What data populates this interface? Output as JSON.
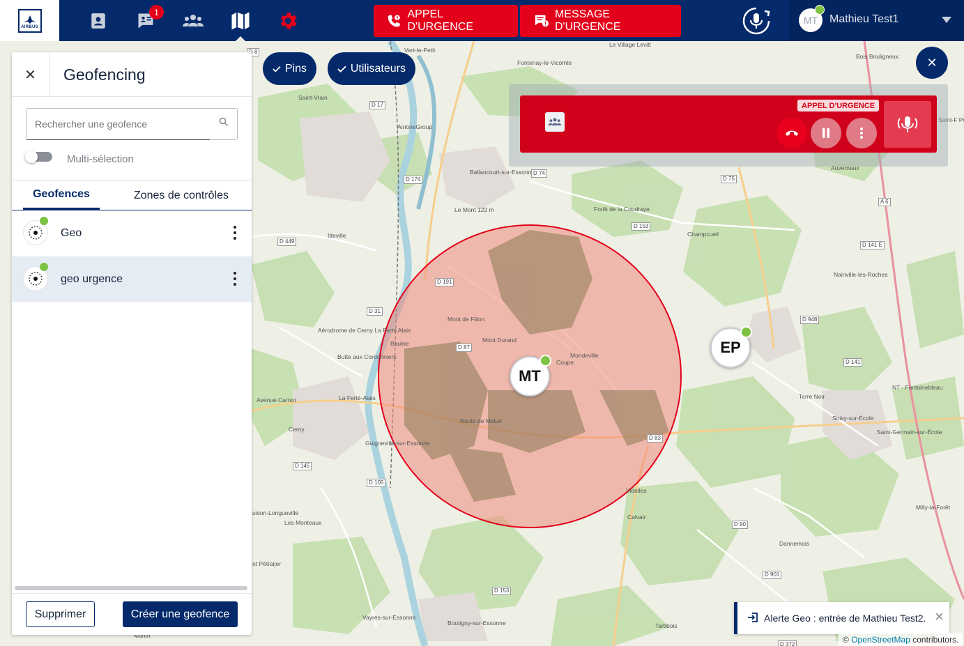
{
  "topbar": {
    "logo_text": "AIRBUS",
    "nav": [
      {
        "name": "contacts"
      },
      {
        "name": "messages",
        "badge": "1"
      },
      {
        "name": "groups"
      },
      {
        "name": "map"
      },
      {
        "name": "settings"
      }
    ],
    "emergency_call_label": "APPEL D'URGENCE",
    "emergency_message_label": "MESSAGE D'URGENCE",
    "user": {
      "initials": "MT",
      "name": "Mathieu Test1",
      "status_color": "#7dc242"
    }
  },
  "panel": {
    "title": "Geofencing",
    "search_placeholder": "Rechercher une geofence",
    "multiselect_label": "Multi-sélection",
    "tabs": [
      {
        "label": "Geofences",
        "active": true
      },
      {
        "label": "Zones de contrôles",
        "active": false
      }
    ],
    "geofences": [
      {
        "name": "Geo",
        "selected": false
      },
      {
        "name": "geo urgence",
        "selected": true
      }
    ],
    "delete_label": "Supprimer",
    "create_label": "Créer une geofence"
  },
  "filters": {
    "pins_label": "Pins",
    "users_label": "Utilisateurs"
  },
  "call_widget": {
    "badge": "APPEL D'URGENCE"
  },
  "markers": [
    {
      "initials": "MT"
    },
    {
      "initials": "EP"
    }
  ],
  "map_labels": {
    "places": [
      "Vert-le-Petit",
      "Fontenay-le-Vicomte",
      "Le Village Levitt",
      "Saint-Vrain",
      "AirioneGroup",
      "Ballancourt-sur-Essonne",
      "Le Mont 122 m",
      "Forêt de la Coudraye",
      "Champcueil",
      "Auvernaux",
      "Itteville",
      "Mont de Fillon",
      "Mont Durand",
      "Baulne",
      "Butte aux Cordonniers",
      "Aérodrome de Cerny La Ferté Alais",
      "Mondeville",
      "Coupe",
      "La Ferté-Alais",
      "Cerny",
      "Guigneville-sur-Essonne",
      "Nainville-les-Roches",
      "Soisy-sur-École",
      "Saint-Germain-sur-École",
      "Terre Noir",
      "Videlles",
      "Calvair",
      "Dannemois",
      "Milly-la-Forêt",
      "uison-Longueville",
      "Les Monteaux",
      "Boutigny-sur-Essonne",
      "Vayres-sur-Essonne",
      "Tartibois",
      "Martin",
      "Saint-F Pont",
      "Bois Bouligneux",
      "Route de Melun",
      "Avenue Carnot",
      "N7 - Fontainebleau",
      "ot Pétraijer",
      "Le Mont"
    ],
    "roads": [
      "D 17",
      "D 174",
      "D 74",
      "D 75",
      "D 153",
      "D 449",
      "D 191",
      "D 87",
      "D 31",
      "D 145",
      "D 105",
      "D 83",
      "D 948",
      "D 141",
      "D 141 E",
      "A 6",
      "D 90",
      "D 901",
      "D 153",
      "D 372",
      "D 8"
    ]
  },
  "toast": {
    "text": "Alerte Geo : entrée de Mathieu Test2."
  },
  "attribution": {
    "prefix": "©",
    "link": "OpenStreetMap",
    "suffix": "contributors."
  }
}
